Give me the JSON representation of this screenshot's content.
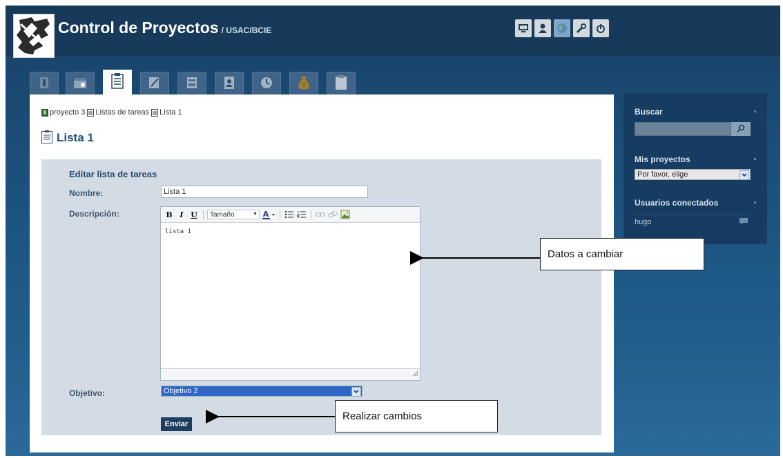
{
  "header": {
    "title": "Control de Proyectos",
    "subtitle": "/ USAC/BCIE",
    "icons": [
      "monitor-icon",
      "user-icon",
      "globe-icon",
      "wrench-icon",
      "power-icon"
    ]
  },
  "tabs": [
    {
      "icon": "info-icon"
    },
    {
      "icon": "calendar-icon"
    },
    {
      "icon": "task-list-icon",
      "active": true
    },
    {
      "icon": "edit-icon"
    },
    {
      "icon": "document-icon"
    },
    {
      "icon": "contact-card-icon"
    },
    {
      "icon": "time-icon"
    },
    {
      "icon": "money-bag-icon"
    },
    {
      "icon": "notepad-icon"
    }
  ],
  "breadcrumb": {
    "project": "proyecto 3",
    "lists": "Listas de tareas",
    "current": "Lista 1"
  },
  "page": {
    "title": "Lista 1"
  },
  "form": {
    "heading": "Editar lista de tareas",
    "name_label": "Nombre:",
    "name_value": "Lista 1",
    "description_label": "Descripción:",
    "editor": {
      "size_label": "Tamaño",
      "content": "lista 1"
    },
    "objective_label": "Objetivo:",
    "objective_value": "Objetivo 2",
    "submit_label": "Enviar"
  },
  "sidebar": {
    "search_title": "Buscar",
    "projects_title": "Mis proyectos",
    "projects_select": "Por favor, elige",
    "users_title": "Usuarios conectados",
    "users": [
      "hugo"
    ]
  },
  "callouts": {
    "datos": "Datos a cambiar",
    "cambios": "Realizar cambios"
  },
  "colors": {
    "header_bg": "#173a5a",
    "form_panel": "#d3dce4",
    "selected_option": "#2e67c6",
    "submit_button": "#1c3f60",
    "sidebar_bg": "#163d61"
  }
}
